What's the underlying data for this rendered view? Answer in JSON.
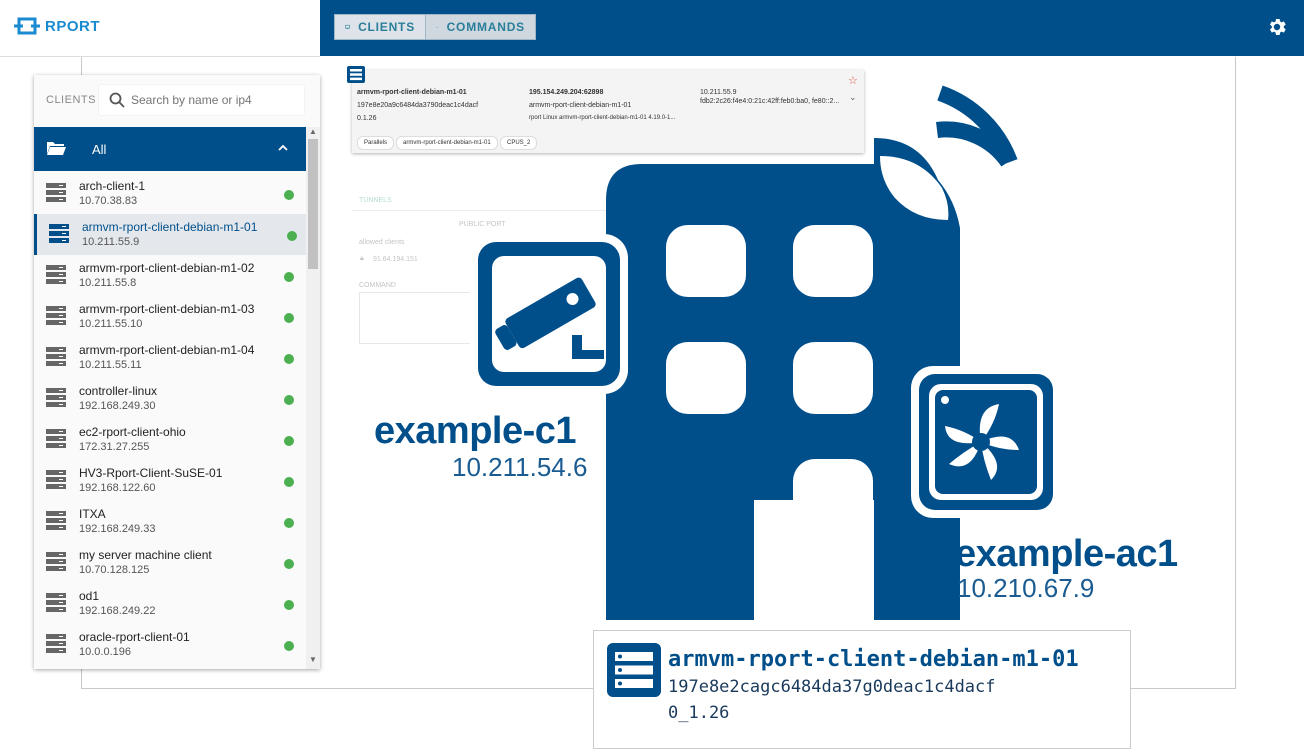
{
  "brand": {
    "logo_text": "RPORT",
    "accent": "#004f8b"
  },
  "nav": {
    "clients_label": "CLIENTS",
    "commands_label": "COMMANDS",
    "settings_icon": "gear-icon"
  },
  "sidebar": {
    "label": "CLIENTS",
    "search_placeholder": "Search by name or ip4",
    "group_label": "All",
    "clients": [
      {
        "name": "arch-client-1",
        "ip": "10.70.38.83",
        "selected": false
      },
      {
        "name": "armvm-rport-client-debian-m1-01",
        "ip": "10.211.55.9",
        "selected": true
      },
      {
        "name": "armvm-rport-client-debian-m1-02",
        "ip": "10.211.55.8",
        "selected": false
      },
      {
        "name": "armvm-rport-client-debian-m1-03",
        "ip": "10.211.55.10",
        "selected": false
      },
      {
        "name": "armvm-rport-client-debian-m1-04",
        "ip": "10.211.55.11",
        "selected": false
      },
      {
        "name": "controller-linux",
        "ip": "192.168.249.30",
        "selected": false
      },
      {
        "name": "ec2-rport-client-ohio",
        "ip": "172.31.27.255",
        "selected": false
      },
      {
        "name": "HV3-Rport-Client-SuSE-01",
        "ip": "192.168.122.60",
        "selected": false
      },
      {
        "name": "ITXA",
        "ip": "192.168.249.33",
        "selected": false
      },
      {
        "name": "my server machine client",
        "ip": "10.70.128.125",
        "selected": false
      },
      {
        "name": "od1",
        "ip": "192.168.249.22",
        "selected": false
      },
      {
        "name": "oracle-rport-client-01",
        "ip": "10.0.0.196",
        "selected": false
      }
    ]
  },
  "detail": {
    "name": "armvm-rport-client-debian-m1-01",
    "id": "197e8e20a9c6484da3790deac1c4dacf",
    "version": "0.1.26",
    "public_addr": "195.154.249.204:62898",
    "hostname": "armvm-rport-client-debian-m1-01",
    "os": "rport Linux armvm-rport-client-debian-m1-01 4.19.0-1...",
    "ipv4": "10.211.55.9",
    "ipv6": "fdb2:2c26:f4e4:0:21c:42ff:feb0:ba0, fe80::2...",
    "tags": [
      "Parallels",
      "armvm-rport-client-debian-m1-01",
      "CPUS_2"
    ],
    "tunnels_tab": "TUNNELS",
    "tunnel_header": "PUBLIC PORT",
    "allowed_clients_label": "allowed clients",
    "port_label": "port",
    "tunnel_ip": "91.64.194.151",
    "tunnel_public_port": "16117",
    "tunnel_port": "22",
    "command_label": "COMMAND"
  },
  "illustration": {
    "camera_name": "example-c1",
    "camera_ip": "10.211.54.6",
    "ac_name": "example-ac1",
    "ac_ip": "10.210.67.9"
  },
  "info_box": {
    "name": "armvm-rport-client-debian-m1-01",
    "id": "197e8e2cagc6484da37g0deac1c4dacf",
    "version": "0_1.26"
  }
}
